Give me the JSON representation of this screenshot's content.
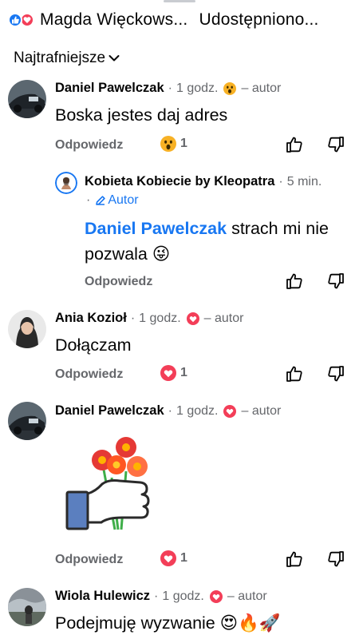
{
  "header": {
    "author": "Magda Więckows...",
    "shared": "Udostępniono..."
  },
  "sort": {
    "label": "Najtrafniejsze"
  },
  "reply_label": "Odpowiedz",
  "comments": [
    {
      "name": "Daniel Pawelczak",
      "time": "1 godz.",
      "reaction_icon": "wow-icon",
      "author_label": "– autor",
      "text": "Boska jestes daj adres",
      "reaction_count": "1",
      "reaction_type": "wow-icon"
    },
    {
      "name": "Kobieta Kobiecie by Kleopatra",
      "time": "5 min.",
      "role": "Autor",
      "mention": "Daniel Pawelczak",
      "text": "strach mi nie pozwala",
      "emoji": "😜"
    },
    {
      "name": "Ania Kozioł",
      "time": "1 godz.",
      "reaction_icon": "love-icon",
      "author_label": "– autor",
      "text": "Dołączam",
      "reaction_count": "1",
      "reaction_type": "love-icon"
    },
    {
      "name": "Daniel Pawelczak",
      "time": "1 godz.",
      "reaction_icon": "love-icon",
      "author_label": "– autor",
      "sticker": "flowers-sticker",
      "reaction_count": "1",
      "reaction_type": "love-icon"
    },
    {
      "name": "Wiola Hulewicz",
      "time": "1 godz.",
      "reaction_icon": "love-icon",
      "author_label": "– autor",
      "text": "Podejmuję wyzwanie",
      "emojis": "😍🔥🚀"
    }
  ],
  "colors": {
    "accent": "#1877f2",
    "love": "#f33e58",
    "secondary_text": "#65676b",
    "wow": "#f7b125"
  }
}
